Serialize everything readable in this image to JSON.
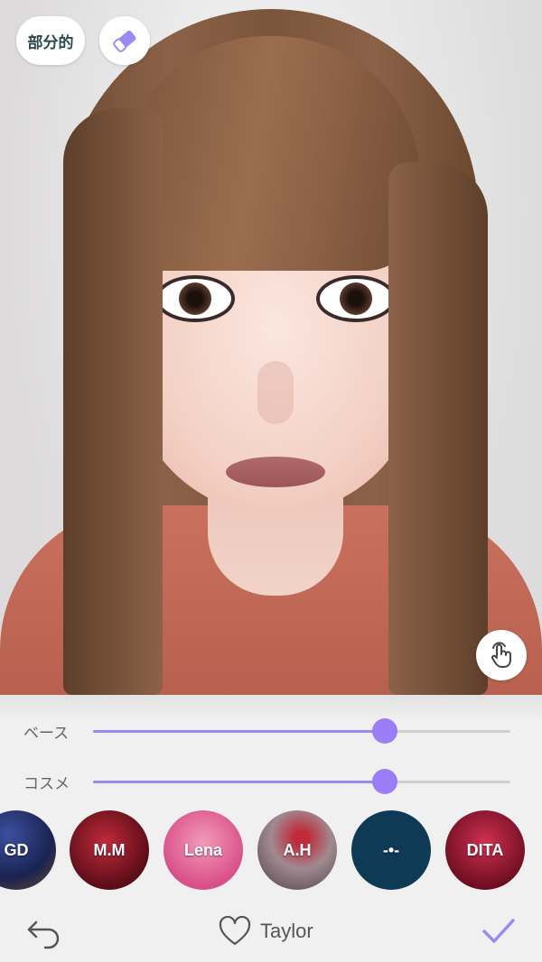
{
  "top_controls": {
    "partial_label": "部分的",
    "eraser_icon": "eraser-icon"
  },
  "touch_icon": "touch-hand-icon",
  "sliders": [
    {
      "label": "ベース",
      "value_fraction": 0.7
    },
    {
      "label": "コスメ",
      "value_fraction": 0.7
    }
  ],
  "swatches": [
    {
      "label": "GD",
      "color": "#2b3a7a"
    },
    {
      "label": "M.M",
      "color": "#8a1a2a"
    },
    {
      "label": "Lena",
      "color": "#e0709a"
    },
    {
      "label": "A.H",
      "color": "#8a6a70"
    },
    {
      "label": "-•-",
      "color": "#0f3a55"
    },
    {
      "label": "DITA",
      "color": "#a0203a"
    }
  ],
  "bottom_bar": {
    "undo_icon": "undo-arrow-icon",
    "favorite_icon": "heart-icon",
    "style_name": "Taylor",
    "confirm_icon": "check-icon"
  },
  "colors": {
    "accent": "#9b7ef5",
    "panel_bg": "#f0f0f0"
  }
}
